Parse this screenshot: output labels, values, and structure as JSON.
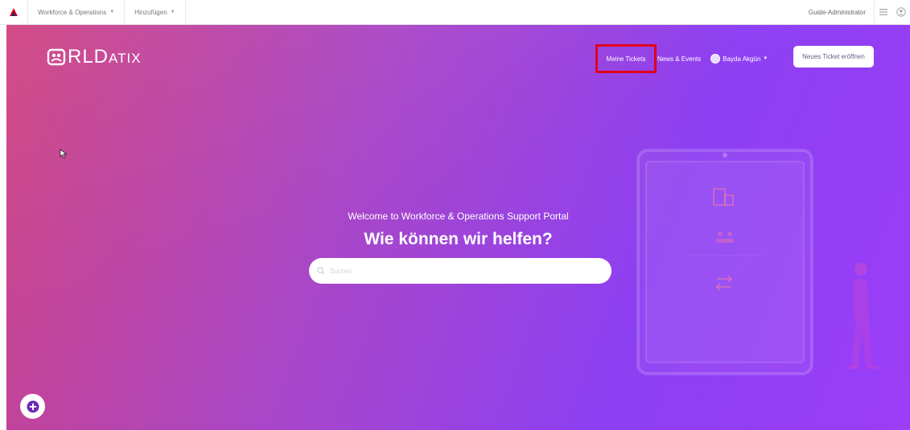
{
  "topbar": {
    "menu_workforce": "Workforce & Operations",
    "menu_add": "Hinzufügen",
    "admin_label": "Guide-Administrator",
    "accent": "#e2001a"
  },
  "brand": {
    "logo_main": "RLD",
    "logo_sub": "ATIX"
  },
  "nav": {
    "my_tickets": "Meine Tickets",
    "news_events": "News & Events",
    "user_name": "Bayda Akgün",
    "new_ticket": "Neues Ticket eröffnen",
    "highlight_color": "#e2001a"
  },
  "hero": {
    "welcome": "Welcome to Workforce & Operations Support Portal",
    "headline": "Wie können wir helfen?",
    "gradient_start": "#d0427f",
    "gradient_end": "#9b3ef7"
  },
  "search": {
    "placeholder": "Suchen",
    "value": ""
  },
  "icons": [
    "triangle-logo-icon",
    "chevron-down-icon",
    "grid-icon",
    "user-circle-icon",
    "search-icon",
    "plus-icon",
    "building-icon",
    "people-icon",
    "transfer-icon"
  ]
}
